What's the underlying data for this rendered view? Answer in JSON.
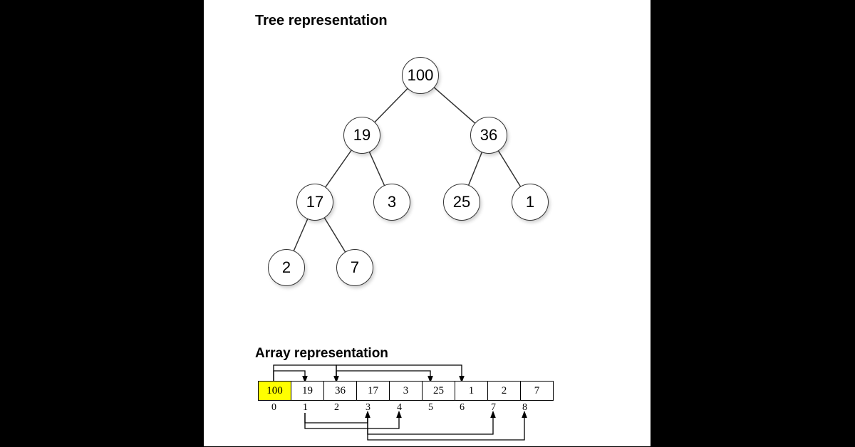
{
  "titles": {
    "tree": "Tree representation",
    "array": "Array representation"
  },
  "tree": {
    "nodes": {
      "n0": "100",
      "n1": "19",
      "n2": "36",
      "n3": "17",
      "n4": "3",
      "n5": "25",
      "n6": "1",
      "n7": "2",
      "n8": "7"
    }
  },
  "array": {
    "values": [
      "100",
      "19",
      "36",
      "17",
      "3",
      "25",
      "1",
      "2",
      "7"
    ],
    "indices": [
      "0",
      "1",
      "2",
      "3",
      "4",
      "5",
      "6",
      "7",
      "8"
    ],
    "highlight_index": 0
  },
  "chart_data": {
    "type": "other",
    "description": "Binary max-heap shown as tree and array",
    "heap_values": [
      100,
      19,
      36,
      17,
      3,
      25,
      1,
      2,
      7
    ],
    "heap_indices": [
      0,
      1,
      2,
      3,
      4,
      5,
      6,
      7,
      8
    ],
    "tree_edges": [
      [
        0,
        1
      ],
      [
        0,
        2
      ],
      [
        1,
        3
      ],
      [
        1,
        4
      ],
      [
        2,
        5
      ],
      [
        2,
        6
      ],
      [
        3,
        7
      ],
      [
        3,
        8
      ]
    ],
    "array_top_arrows": [
      [
        0,
        1
      ],
      [
        0,
        2
      ],
      [
        2,
        5
      ],
      [
        2,
        6
      ]
    ],
    "array_bottom_arrows": [
      [
        1,
        3
      ],
      [
        1,
        4
      ],
      [
        3,
        7
      ],
      [
        3,
        8
      ]
    ],
    "highlighted_array_index": 0
  }
}
